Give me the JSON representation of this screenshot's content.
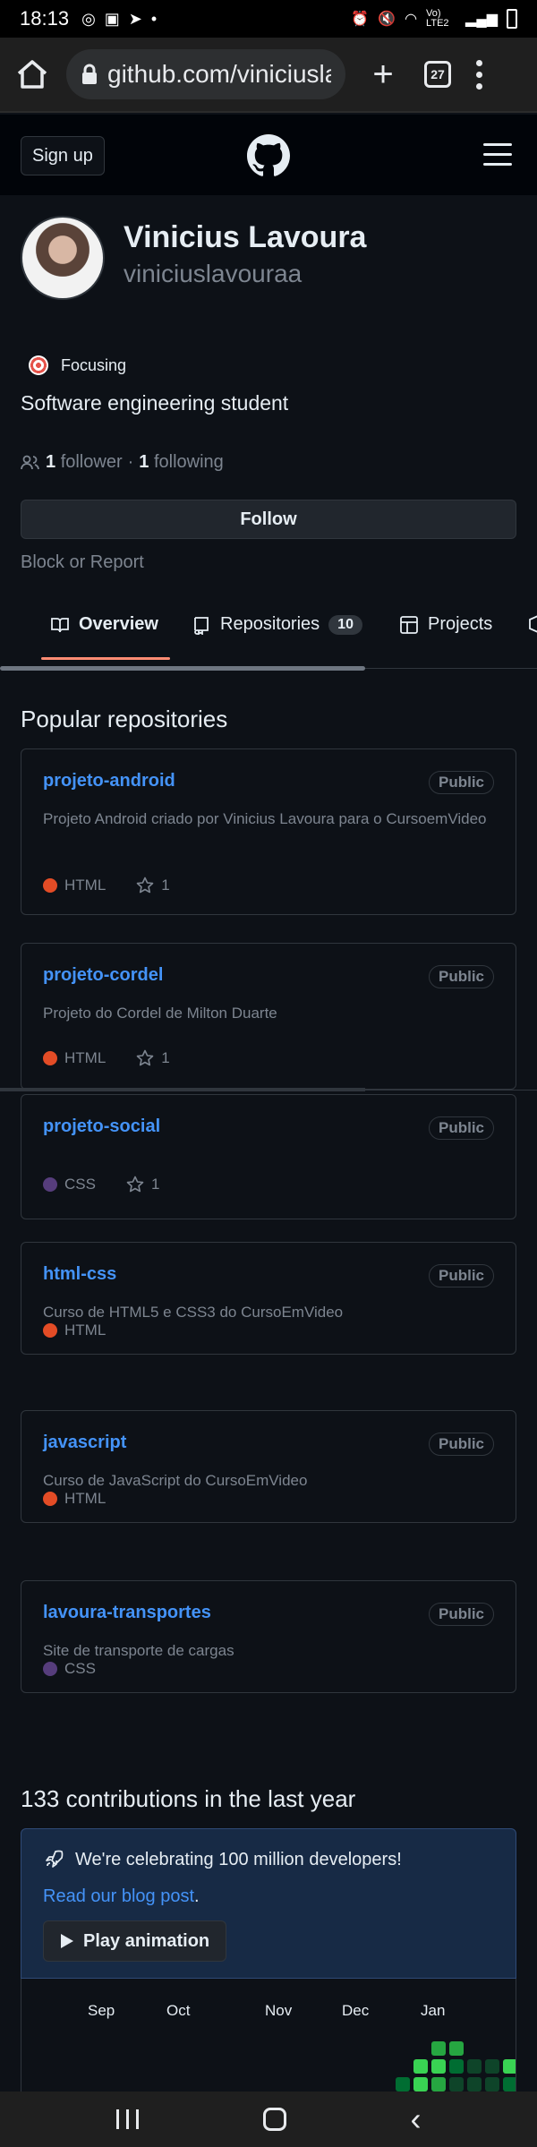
{
  "statusbar": {
    "time": "18:13",
    "signal": "Vo) LTE2"
  },
  "browser": {
    "url": "github.com/viniciusla",
    "tab_count": "27"
  },
  "header": {
    "signup": "Sign up"
  },
  "profile": {
    "name": "Vinicius Lavoura",
    "login": "viniciuslavouraa",
    "status": "Focusing",
    "bio": "Software engineering student",
    "followers_count": "1",
    "followers_label": "follower",
    "separator": "·",
    "following_count": "1",
    "following_label": "following",
    "follow_button": "Follow",
    "block_report": "Block or Report"
  },
  "tabs": [
    {
      "label": "Overview"
    },
    {
      "label": "Repositories",
      "count": "10"
    },
    {
      "label": "Projects"
    }
  ],
  "popular": {
    "title": "Popular repositories",
    "repos": [
      {
        "name": "projeto-android",
        "visibility": "Public",
        "description": "Projeto Android criado por Vinicius Lavoura para o CursoemVideo",
        "language": "HTML",
        "lang_color": "#e34c26",
        "stars": "1"
      },
      {
        "name": "projeto-cordel",
        "visibility": "Public",
        "description": "Projeto do Cordel de Milton Duarte",
        "language": "HTML",
        "lang_color": "#e34c26",
        "stars": "1"
      },
      {
        "name": "projeto-social",
        "visibility": "Public",
        "description": "",
        "language": "CSS",
        "lang_color": "#563d7c",
        "stars": "1"
      },
      {
        "name": "html-css",
        "visibility": "Public",
        "description": "Curso de HTML5 e CSS3 do CursoEmVideo",
        "language": "HTML",
        "lang_color": "#e34c26",
        "stars": ""
      },
      {
        "name": "javascript",
        "visibility": "Public",
        "description": "Curso de JavaScript do CursoEmVideo",
        "language": "HTML",
        "lang_color": "#e34c26",
        "stars": ""
      },
      {
        "name": "lavoura-transportes",
        "visibility": "Public",
        "description": "Site de transporte de cargas",
        "language": "CSS",
        "lang_color": "#563d7c",
        "stars": ""
      }
    ]
  },
  "contributions": {
    "title": "133 contributions in the last year",
    "celebrate_text": "We're celebrating 100 million developers!",
    "blog_link": "Read our blog post",
    "blog_suffix": ".",
    "play_button": "Play animation",
    "months": [
      "Sep",
      "Oct",
      "Nov",
      "Dec",
      "Jan"
    ],
    "colors": {
      "l1": "#0e4429",
      "l2": "#006d32",
      "l3": "#26a641",
      "l4": "#39d353"
    }
  }
}
